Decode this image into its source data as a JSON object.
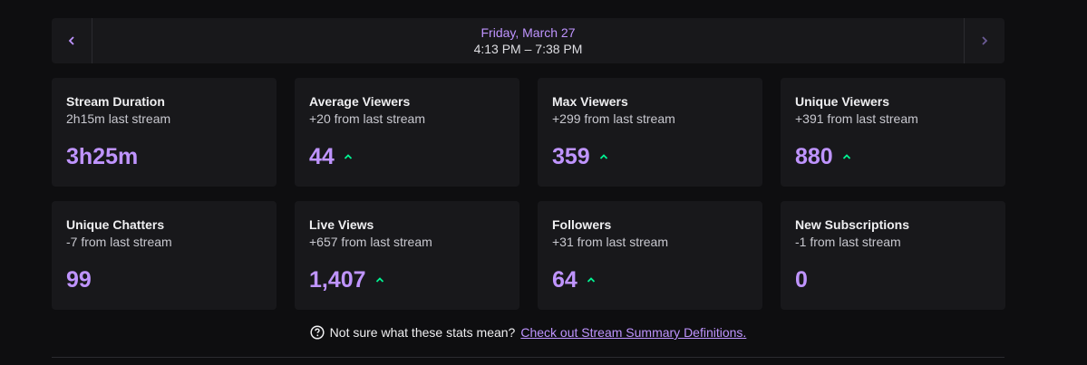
{
  "date_nav": {
    "prev_icon": "chevron-left-icon",
    "next_icon": "chevron-right-icon",
    "date": "Friday, March 27",
    "time_range": "4:13 PM – 7:38 PM"
  },
  "stats": [
    {
      "title": "Stream Duration",
      "sub": "2h15m last stream",
      "value": "3h25m",
      "trend": "none"
    },
    {
      "title": "Average Viewers",
      "sub": "+20 from last stream",
      "value": "44",
      "trend": "up"
    },
    {
      "title": "Max Viewers",
      "sub": "+299 from last stream",
      "value": "359",
      "trend": "up"
    },
    {
      "title": "Unique Viewers",
      "sub": "+391 from last stream",
      "value": "880",
      "trend": "up"
    },
    {
      "title": "Unique Chatters",
      "sub": "-7 from last stream",
      "value": "99",
      "trend": "none"
    },
    {
      "title": "Live Views",
      "sub": "+657 from last stream",
      "value": "1,407",
      "trend": "up"
    },
    {
      "title": "Followers",
      "sub": "+31 from last stream",
      "value": "64",
      "trend": "up"
    },
    {
      "title": "New Subscriptions",
      "sub": "-1 from last stream",
      "value": "0",
      "trend": "none"
    }
  ],
  "footer": {
    "question": "Not sure what these stats mean?",
    "link": "Check out Stream Summary Definitions."
  },
  "colors": {
    "accent": "#bf94ff",
    "up": "#00f593",
    "card_bg": "#18181b",
    "page_bg": "#0e0e10"
  }
}
